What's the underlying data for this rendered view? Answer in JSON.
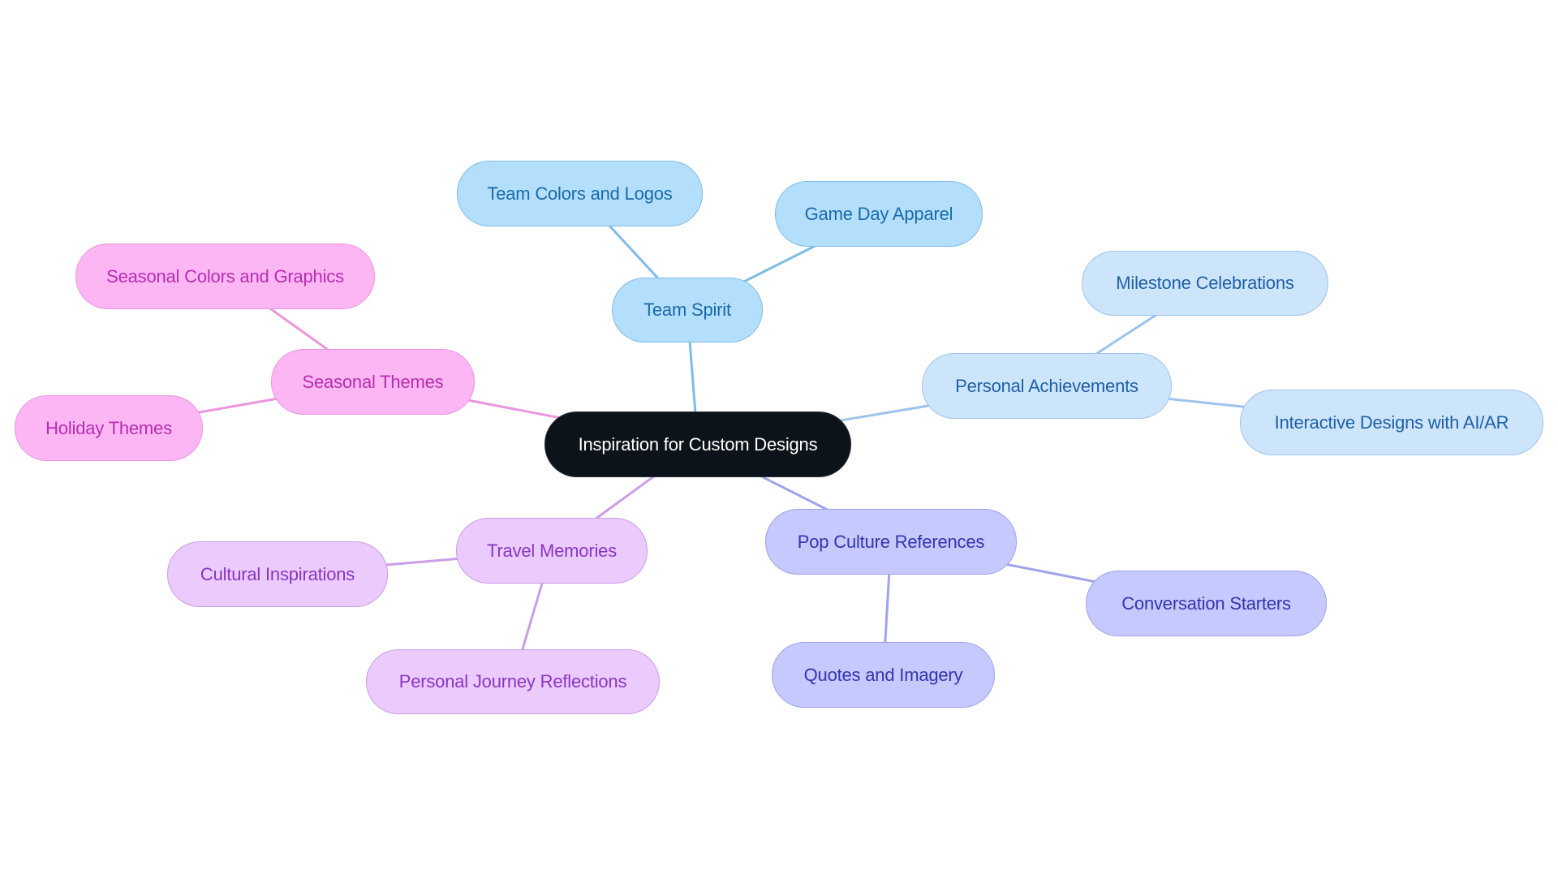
{
  "title": "Inspiration for Custom Designs mind map",
  "root": {
    "id": "root",
    "label": "Inspiration for Custom Designs"
  },
  "branches": [
    {
      "id": "team-spirit",
      "label": "Team Spirit",
      "style": "b1",
      "edge_color": "#7fbce6",
      "children": [
        {
          "id": "team-colors",
          "label": "Team Colors and Logos"
        },
        {
          "id": "game-day",
          "label": "Game Day Apparel"
        }
      ]
    },
    {
      "id": "personal-achievements",
      "label": "Personal Achievements",
      "style": "b2",
      "edge_color": "#9cc3ec",
      "children": [
        {
          "id": "milestone",
          "label": "Milestone Celebrations"
        },
        {
          "id": "interactive",
          "label": "Interactive Designs with AI/AR"
        }
      ]
    },
    {
      "id": "pop-culture",
      "label": "Pop Culture References",
      "style": "b3",
      "edge_color": "#9ea3ea",
      "children": [
        {
          "id": "conversation",
          "label": "Conversation Starters"
        },
        {
          "id": "quotes",
          "label": "Quotes and Imagery"
        }
      ]
    },
    {
      "id": "travel",
      "label": "Travel Memories",
      "style": "b4",
      "edge_color": "#cc9ce8",
      "children": [
        {
          "id": "cultural",
          "label": "Cultural Inspirations"
        },
        {
          "id": "journey",
          "label": "Personal Journey Reflections"
        }
      ]
    },
    {
      "id": "seasonal",
      "label": "Seasonal Themes",
      "style": "b5",
      "edge_color": "#ea96de",
      "children": [
        {
          "id": "seasonal-colors",
          "label": "Seasonal Colors and Graphics"
        },
        {
          "id": "holiday",
          "label": "Holiday Themes"
        }
      ]
    }
  ]
}
